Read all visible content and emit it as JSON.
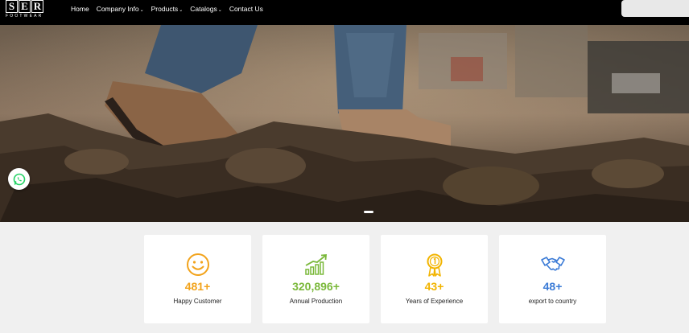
{
  "logo": {
    "letters": [
      "S",
      "E",
      "R"
    ],
    "subtitle": "FOOTWEAR"
  },
  "nav": [
    {
      "label": "Home",
      "dropdown": false
    },
    {
      "label": "Company Info",
      "dropdown": true
    },
    {
      "label": "Products",
      "dropdown": true
    },
    {
      "label": "Catalogs",
      "dropdown": true
    },
    {
      "label": "Contact Us",
      "dropdown": false
    }
  ],
  "search": {
    "placeholder": ""
  },
  "slider": {
    "active_slide": 1
  },
  "stats": [
    {
      "value": "481+",
      "label": "Happy Customer",
      "icon": "smiley-icon",
      "color": "#f2a31b"
    },
    {
      "value": "320,896+",
      "label": "Annual Production",
      "icon": "growth-chart-icon",
      "color": "#7ab83a"
    },
    {
      "value": "43+",
      "label": "Years of Experience",
      "icon": "award-medal-icon",
      "color": "#f2b400"
    },
    {
      "value": "48+",
      "label": "export to country",
      "icon": "handshake-icon",
      "color": "#3b7bd6"
    }
  ]
}
